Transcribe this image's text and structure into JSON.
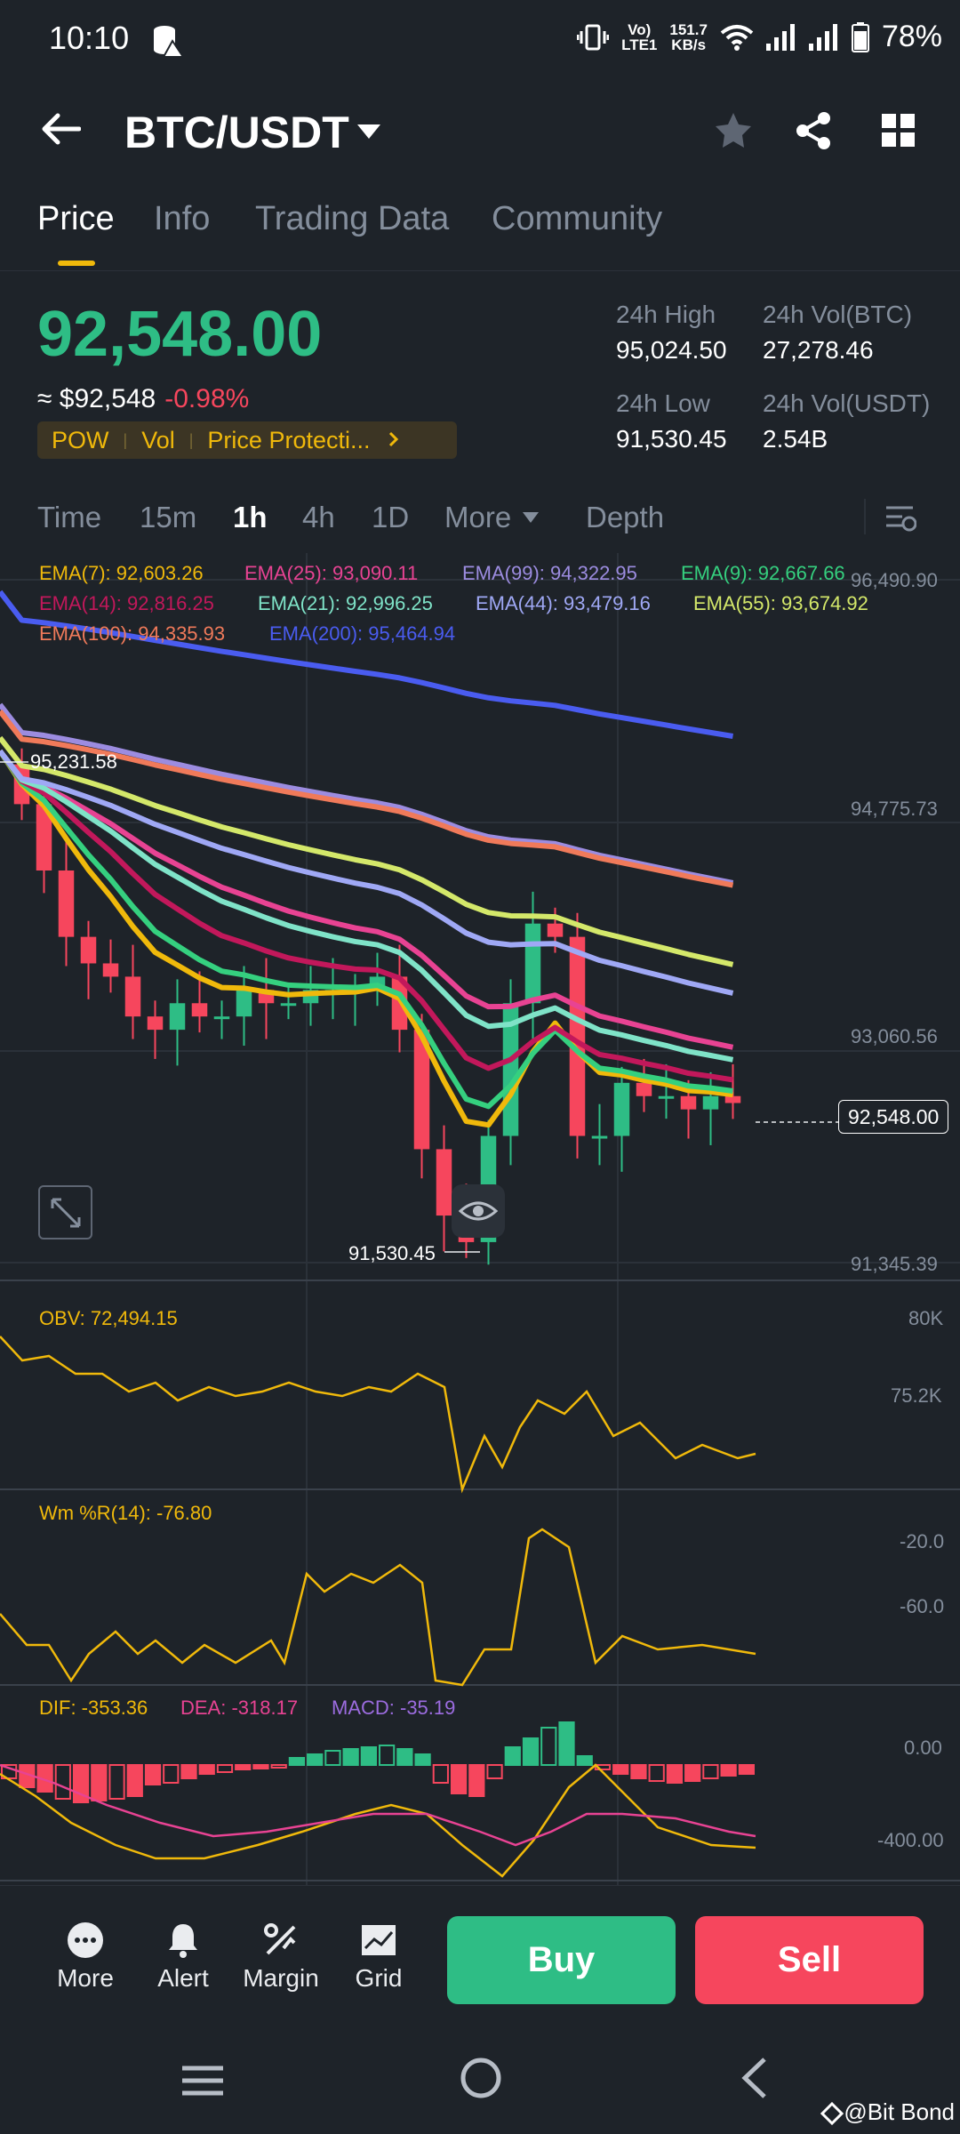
{
  "status_bar": {
    "time": "10:10",
    "net_top": "Vo)",
    "net_bottom": "LTE1",
    "speed_top": "151.7",
    "speed_bottom": "KB/s",
    "battery": "78%"
  },
  "header": {
    "pair": "BTC/USDT"
  },
  "tabs": [
    {
      "label": "Price"
    },
    {
      "label": "Info"
    },
    {
      "label": "Trading Data"
    },
    {
      "label": "Community"
    }
  ],
  "ticker": {
    "price": "92,548.00",
    "fiat": "≈ $92,548",
    "change": "-0.98%",
    "tags": [
      "POW",
      "Vol",
      "Price Protecti..."
    ],
    "high_label": "24h High",
    "high": "95,024.50",
    "low_label": "24h Low",
    "low": "91,530.45",
    "vol_btc_label": "24h Vol(BTC)",
    "vol_btc": "27,278.46",
    "vol_usdt_label": "24h Vol(USDT)",
    "vol_usdt": "2.54B"
  },
  "intervals": {
    "items": [
      "Time",
      "15m",
      "1h",
      "4h",
      "1D",
      "More"
    ],
    "selected": "1h",
    "depth": "Depth"
  },
  "colors": {
    "up": "#2ebd85",
    "down": "#f6465d",
    "accent": "#f0b90b",
    "bg": "#1e2329"
  },
  "ema_legend": [
    {
      "text": "EMA(7): 92,603.26",
      "color": "#f0b90b"
    },
    {
      "text": "EMA(25): 93,090.11",
      "color": "#e84393"
    },
    {
      "text": "EMA(99): 94,322.95",
      "color": "#9c8ce0"
    },
    {
      "text": "EMA(9): 92,667.66",
      "color": "#35d07f"
    },
    {
      "text": "EMA(14): 92,816.25",
      "color": "#c2185b"
    },
    {
      "text": "EMA(21): 92,996.25",
      "color": "#7fe3c8"
    },
    {
      "text": "EMA(44): 93,479.16",
      "color": "#9fa8f5"
    },
    {
      "text": "EMA(55): 93,674.92",
      "color": "#d4e86a"
    },
    {
      "text": "EMA(100): 94,335.93",
      "color": "#f07a5a"
    },
    {
      "text": "EMA(200): 95,464.94",
      "color": "#4a5cf0"
    }
  ],
  "price_axis": [
    "96,490.90",
    "94,775.73",
    "93,060.56",
    "91,345.39"
  ],
  "markers": {
    "high": "95,231.58",
    "low": "91,530.45",
    "last": "92,548.00"
  },
  "obv": {
    "label": "OBV: 72,494.15",
    "axis": [
      "80K",
      "75.2K"
    ]
  },
  "wr": {
    "label": "Wm %R(14): -76.80",
    "axis": [
      "-20.0",
      "-60.0"
    ]
  },
  "macd": {
    "dif": "DIF: -353.36",
    "dea": "DEA: -318.17",
    "macd": "MACD: -35.19",
    "axis": [
      "0.00",
      "-400.00"
    ]
  },
  "bottom": {
    "more": "More",
    "alert": "Alert",
    "margin": "Margin",
    "grid": "Grid",
    "buy": "Buy",
    "sell": "Sell"
  },
  "watermark": "@Bit Bond",
  "chart_data": {
    "type": "candlestick",
    "candles_close_approx": [
      94800,
      94300,
      93800,
      93600,
      93500,
      93200,
      93100,
      93300,
      93200,
      93200,
      93400,
      93300,
      93300,
      93400,
      93400,
      93400,
      93500,
      93100,
      92200,
      91700,
      91500,
      92300,
      93300,
      93900,
      93800,
      92300,
      92300,
      92700,
      92600,
      92600,
      92500,
      92600,
      92548
    ],
    "ylim": [
      91345.39,
      96490.9
    ]
  }
}
